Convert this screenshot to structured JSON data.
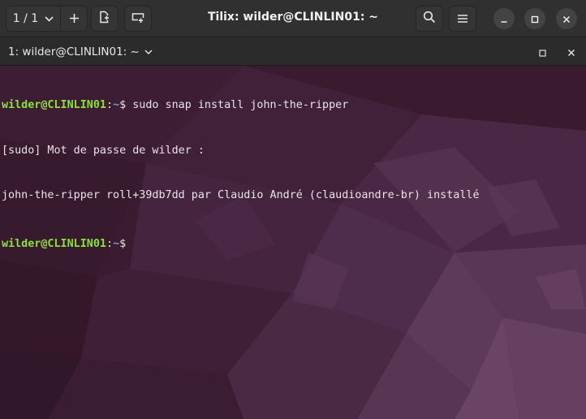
{
  "headerbar": {
    "session_counter": "1 / 1",
    "title": "Tilix: wilder@CLINLIN01: ~"
  },
  "terminal_tab": {
    "title": "1: wilder@CLINLIN01: ~"
  },
  "terminal": {
    "lines": [
      {
        "user": "wilder@CLINLIN01",
        "sep": ":",
        "path": "~",
        "tail": "$ sudo snap install john-the-ripper"
      },
      {
        "text": "[sudo] Mot de passe de wilder :"
      },
      {
        "text": "john-the-ripper roll+39db7dd par Claudio André (claudioandre-br) installé"
      },
      {
        "user": "wilder@CLINLIN01",
        "sep": ":",
        "path": "~",
        "tail": "$"
      }
    ]
  },
  "colors": {
    "prompt_user": "#8ae234",
    "prompt_path": "#729fcf",
    "terminal_text": "#e8e4e8",
    "terminal_bg": "#3a1b30"
  },
  "icons": {
    "session_dropdown": "chevron-down-icon",
    "add_session": "plus-icon",
    "new_session_in_right": "add-terminal-right-icon",
    "new_session_below": "add-terminal-down-icon",
    "search": "search-icon",
    "menu": "hamburger-menu-icon",
    "minimize": "minimize-icon",
    "maximize": "maximize-icon",
    "close": "close-icon"
  }
}
